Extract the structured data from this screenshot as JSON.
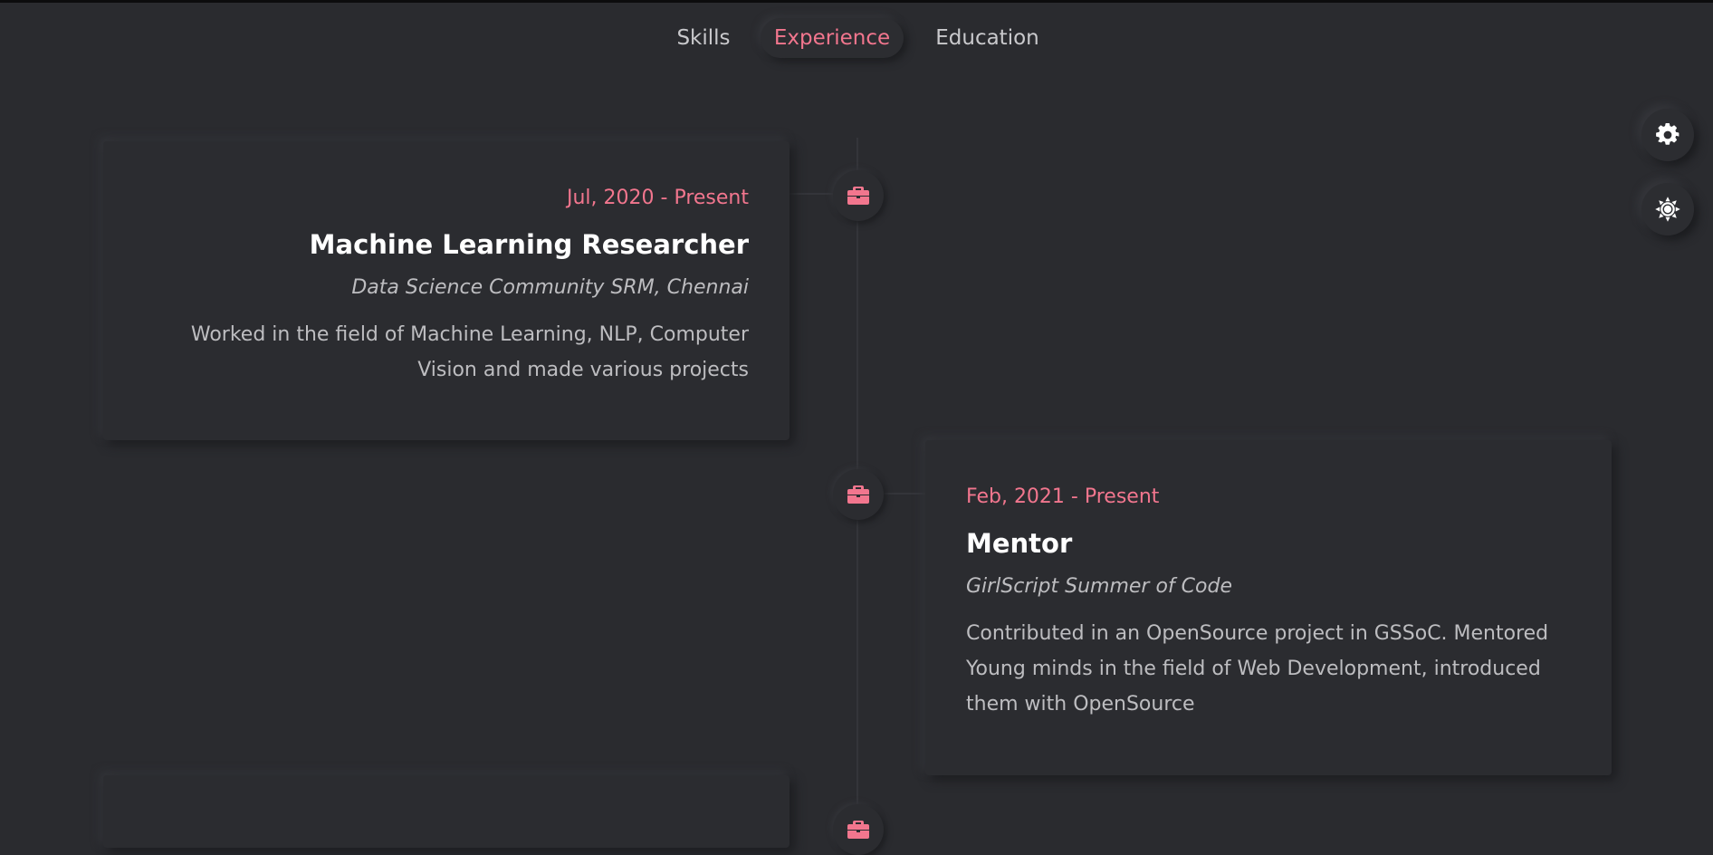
{
  "nav": {
    "tabs": [
      {
        "label": "Skills"
      },
      {
        "label": "Experience",
        "active": true
      },
      {
        "label": "Education"
      }
    ],
    "active_color": "#f2768e"
  },
  "side_controls": {
    "settings_icon": "gear-icon",
    "theme_icon": "sun-icon"
  },
  "timeline": {
    "node_icon": "briefcase-icon",
    "items": [
      {
        "date": "Jul, 2020 - Present",
        "role": "Machine Learning Researcher",
        "org": "Data Science Community SRM, Chennai",
        "description": "Worked in the field of Machine Learning, NLP, Computer Vision and made various projects"
      },
      {
        "date": "Feb, 2021 - Present",
        "role": "Mentor",
        "org": "GirlScript Summer of Code",
        "description": "Contributed in an OpenSource project in GSSoC. Mentored Young minds in the field of Web Development, introduced them with OpenSource"
      }
    ]
  },
  "colors": {
    "background": "#2a2b2f",
    "accent": "#f2768e",
    "heading": "#ffffff",
    "text": "#bdbdc0"
  }
}
